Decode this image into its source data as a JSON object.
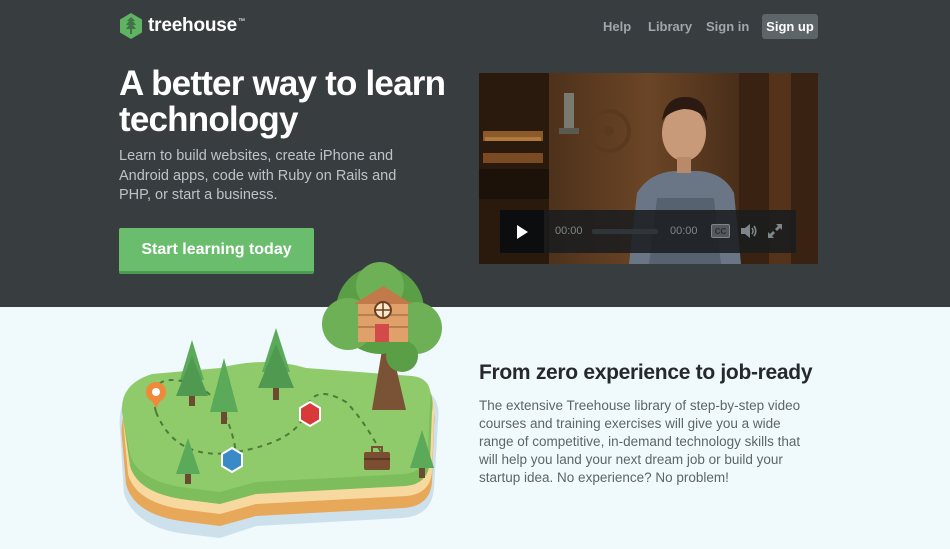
{
  "brand": {
    "name": "treehouse",
    "trademark": "™",
    "icon": "treehouse-logo-icon"
  },
  "nav": {
    "items": [
      {
        "label": "Help"
      },
      {
        "label": "Library"
      },
      {
        "label": "Sign in"
      }
    ],
    "signup_label": "Sign up"
  },
  "hero": {
    "headline": "A better way to learn technology",
    "subtext": "Learn to build websites, create iPhone and Android apps, code with Ruby on Rails and PHP, or start a business.",
    "cta_label": "Start learning today"
  },
  "video": {
    "current_time": "00:00",
    "duration": "00:00",
    "cc_label": "CC",
    "progress": 0,
    "icons": [
      "play-icon",
      "volume-icon",
      "fullscreen-icon"
    ]
  },
  "section": {
    "title": "From zero experience to job-ready",
    "body": "The extensive Treehouse library of step-by-step video courses and training exercises will give you a wide range of competitive, in-demand technology skills that will help you land your next dream job or build your startup idea. No experience? No problem!"
  },
  "colors": {
    "hero_bg": "#383d40",
    "page_bg": "#f0f9fb",
    "accent_green": "#6bbd6e",
    "nav_text": "#9ea7ac"
  }
}
